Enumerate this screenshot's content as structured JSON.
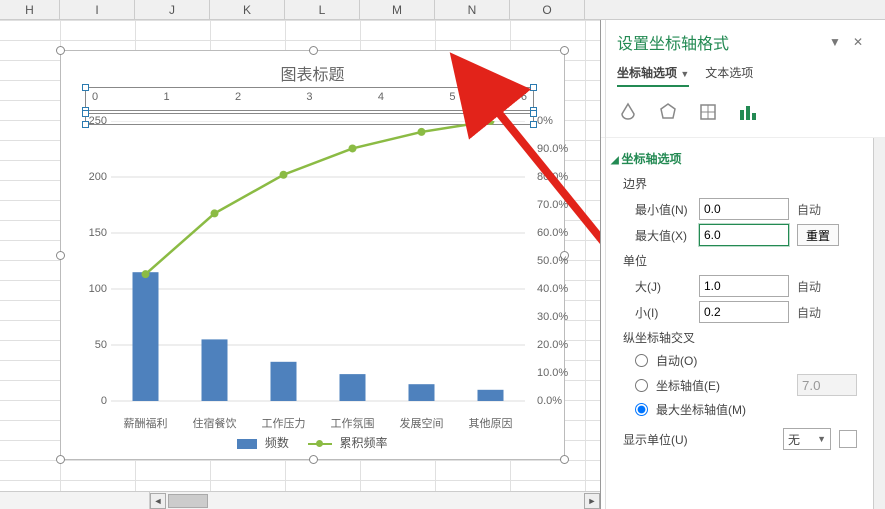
{
  "columns": [
    "H",
    "I",
    "J",
    "K",
    "L",
    "M",
    "N",
    "O"
  ],
  "chart": {
    "title": "图表标题",
    "top_axis": [
      "0",
      "1",
      "2",
      "3",
      "4",
      "5",
      "6"
    ],
    "y_ticks": [
      "0",
      "50",
      "100",
      "150",
      "200",
      "250"
    ],
    "y2_ticks": [
      "0.0%",
      "10.0%",
      "20.0%",
      "30.0%",
      "40.0%",
      "50.0%",
      "60.0%",
      "70.0%",
      "80.0%",
      "90.0%",
      "0%"
    ],
    "categories": [
      "薪酬福利",
      "住宿餐饮",
      "工作压力",
      "工作氛围",
      "发展空间",
      "其他原因"
    ],
    "legend_bar": "频数",
    "legend_line": "累积频率"
  },
  "chart_data": {
    "type": "bar",
    "title": "图表标题",
    "categories": [
      "薪酬福利",
      "住宿餐饮",
      "工作压力",
      "工作氛围",
      "发展空间",
      "其他原因"
    ],
    "series": [
      {
        "name": "频数",
        "type": "bar",
        "axis": "primary",
        "values": [
          115,
          55,
          35,
          24,
          15,
          10
        ]
      },
      {
        "name": "累积频率",
        "type": "line",
        "axis": "secondary",
        "values": [
          0.453,
          0.67,
          0.808,
          0.902,
          0.961,
          1.0
        ]
      }
    ],
    "xlabel": "",
    "ylabel": "",
    "ylim": [
      0,
      250
    ],
    "y2lim": [
      0.0,
      1.0
    ],
    "secondary_horizontal_axis": {
      "min": 0,
      "max": 6
    }
  },
  "pane": {
    "title": "设置坐标轴格式",
    "tab_axis": "坐标轴选项",
    "tab_text": "文本选项",
    "section_axis": "坐标轴选项",
    "bounds": "边界",
    "min_label": "最小值(N)",
    "min_value": "0.0",
    "min_auto": "自动",
    "max_label": "最大值(X)",
    "max_value": "6.0",
    "max_reset": "重置",
    "unit": "单位",
    "major_label": "大(J)",
    "major_value": "1.0",
    "major_auto": "自动",
    "minor_label": "小(I)",
    "minor_value": "0.2",
    "minor_auto": "自动",
    "crosses": "纵坐标轴交叉",
    "cross_auto": "自动(O)",
    "cross_value": "坐标轴值(E)",
    "cross_value_num": "7.0",
    "cross_max": "最大坐标轴值(M)",
    "display_unit": "显示单位(U)",
    "display_unit_value": "无"
  }
}
